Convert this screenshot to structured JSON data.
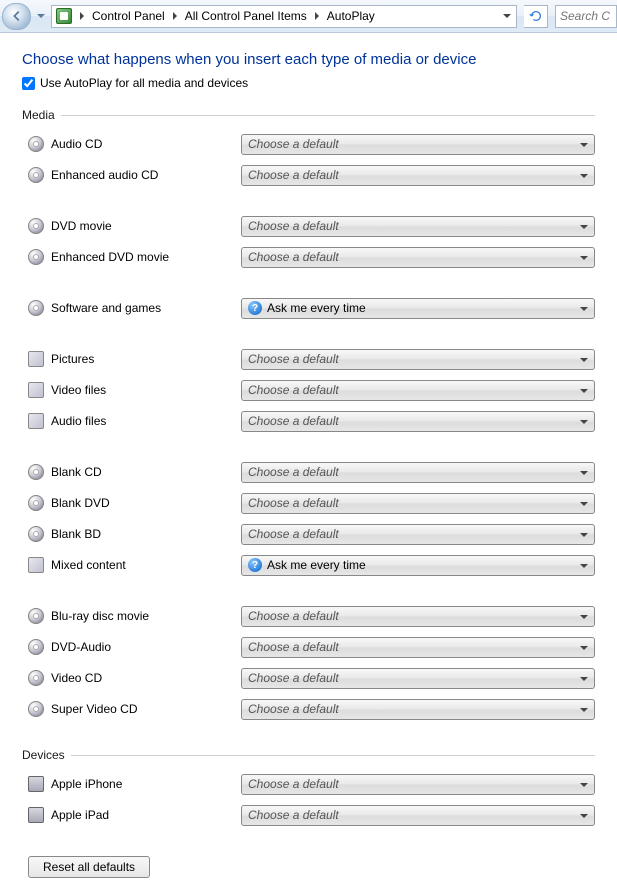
{
  "breadcrumb": {
    "items": [
      "Control Panel",
      "All Control Panel Items",
      "AutoPlay"
    ]
  },
  "search_placeholder": "Search C",
  "page_title": "Choose what happens when you insert each type of media or device",
  "use_autoplay_label": "Use AutoPlay for all media and devices",
  "use_autoplay_checked": true,
  "sections": {
    "media_label": "Media",
    "devices_label": "Devices"
  },
  "default_option": "Choose a default",
  "ask_option": "Ask me every time",
  "media_items": [
    {
      "label": "Audio CD",
      "value": "Choose a default",
      "icon": "disc",
      "ask": false
    },
    {
      "label": "Enhanced audio CD",
      "value": "Choose a default",
      "icon": "disc",
      "ask": false
    }
  ],
  "media_items2": [
    {
      "label": "DVD movie",
      "value": "Choose a default",
      "icon": "disc",
      "ask": false
    },
    {
      "label": "Enhanced DVD movie",
      "value": "Choose a default",
      "icon": "disc",
      "ask": false
    }
  ],
  "media_items3": [
    {
      "label": "Software and games",
      "value": "Ask me every time",
      "icon": "disc",
      "ask": true
    }
  ],
  "media_items4": [
    {
      "label": "Pictures",
      "value": "Choose a default",
      "icon": "sq",
      "ask": false
    },
    {
      "label": "Video files",
      "value": "Choose a default",
      "icon": "sq",
      "ask": false
    },
    {
      "label": "Audio files",
      "value": "Choose a default",
      "icon": "sq",
      "ask": false
    }
  ],
  "media_items5": [
    {
      "label": "Blank CD",
      "value": "Choose a default",
      "icon": "disc",
      "ask": false
    },
    {
      "label": "Blank DVD",
      "value": "Choose a default",
      "icon": "disc",
      "ask": false
    },
    {
      "label": "Blank BD",
      "value": "Choose a default",
      "icon": "disc",
      "ask": false
    },
    {
      "label": "Mixed content",
      "value": "Ask me every time",
      "icon": "sq",
      "ask": true
    }
  ],
  "media_items6": [
    {
      "label": "Blu-ray disc movie",
      "value": "Choose a default",
      "icon": "disc",
      "ask": false
    },
    {
      "label": "DVD-Audio",
      "value": "Choose a default",
      "icon": "disc",
      "ask": false
    },
    {
      "label": "Video CD",
      "value": "Choose a default",
      "icon": "disc",
      "ask": false
    },
    {
      "label": "Super Video CD",
      "value": "Choose a default",
      "icon": "disc",
      "ask": false
    }
  ],
  "device_items": [
    {
      "label": "Apple iPhone",
      "value": "Choose a default",
      "icon": "dev",
      "ask": false
    },
    {
      "label": "Apple iPad",
      "value": "Choose a default",
      "icon": "dev",
      "ask": false
    }
  ],
  "reset_label": "Reset all defaults"
}
